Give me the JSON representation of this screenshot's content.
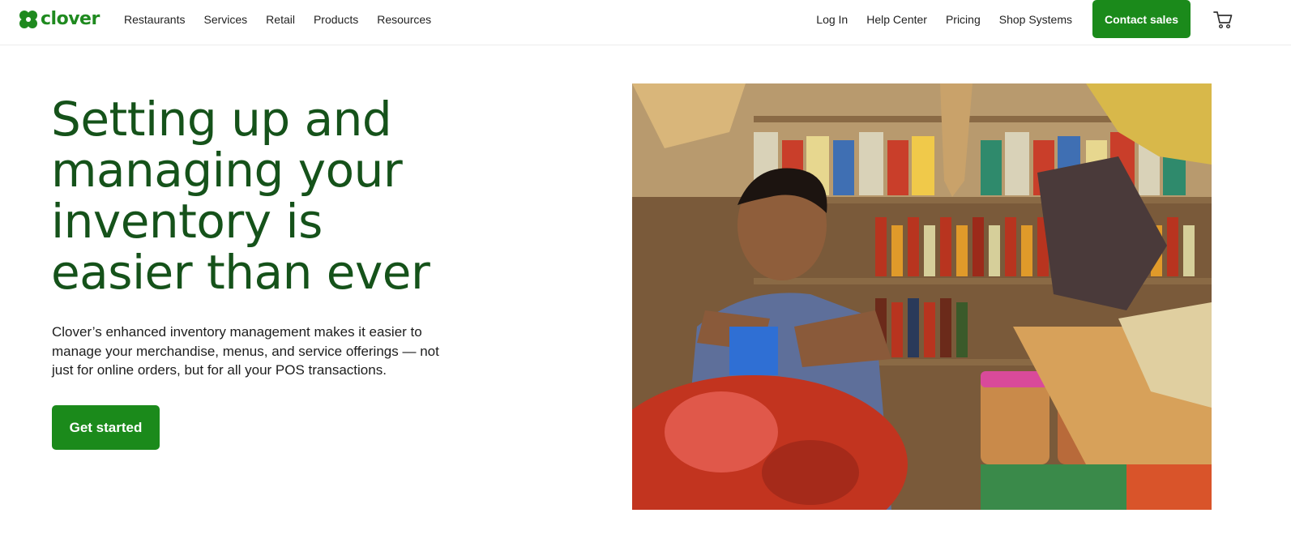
{
  "brand": {
    "name": "clover",
    "color": "#1f8a1f"
  },
  "nav": {
    "left": [
      {
        "label": "Restaurants"
      },
      {
        "label": "Services"
      },
      {
        "label": "Retail"
      },
      {
        "label": "Products"
      },
      {
        "label": "Resources"
      }
    ],
    "right": [
      {
        "label": "Log In"
      },
      {
        "label": "Help Center"
      },
      {
        "label": "Pricing"
      },
      {
        "label": "Shop Systems"
      }
    ],
    "contact_label": "Contact sales",
    "cart_icon": "shopping-cart-icon"
  },
  "hero": {
    "title_lines": [
      "Setting up and",
      "managing your",
      "inventory is",
      "easier than ever"
    ],
    "description": "Clover’s enhanced inventory management makes it easier to manage your merchandise, menus, and service offerings — not just for online orders, but for all your POS transactions.",
    "cta_label": "Get started",
    "accent": "#1b8a1b",
    "title_color": "#15521a"
  }
}
